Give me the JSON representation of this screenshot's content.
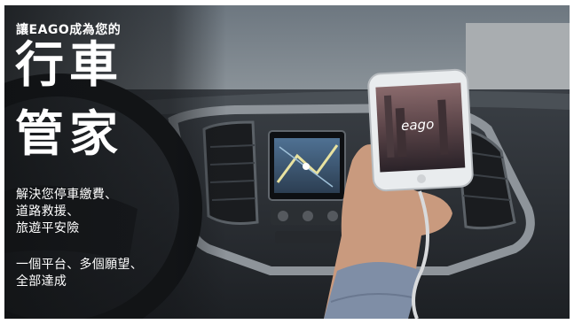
{
  "banner": {
    "tagline": "讓EAGO成為您的",
    "headline_line1": "行車",
    "headline_line2": "管家",
    "features_group1": [
      "解決您停車繳費、",
      "道路救援、",
      "旅遊平安險"
    ],
    "features_group2": [
      "一個平台、多個願望、",
      "全部達成"
    ]
  },
  "phone": {
    "app_logo": "eago"
  },
  "colors": {
    "text": "#ffffff",
    "overlay": "#1b1d20",
    "nav_screen": "#3d5a7a"
  }
}
